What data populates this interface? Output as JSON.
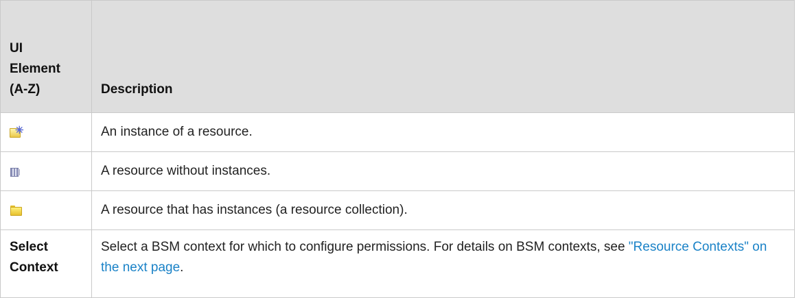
{
  "table": {
    "header": {
      "col1_lines": [
        "UI",
        "Element",
        "(A-Z)"
      ],
      "col2": "Description"
    },
    "rows": [
      {
        "icon": "resource-instance-icon",
        "description": "An instance of a resource."
      },
      {
        "icon": "resource-no-instances-icon",
        "description": "A resource without instances."
      },
      {
        "icon": "resource-collection-folder-icon",
        "description": "A resource that has instances (a resource collection)."
      }
    ],
    "select_context": {
      "label_lines": [
        "Select",
        "Context"
      ],
      "text_before": "Select a BSM context for which to configure permissions. For details on BSM contexts, see ",
      "link": "\"Resource Contexts\" on the next page",
      "text_after": "."
    }
  },
  "colors": {
    "header_bg": "#dedede",
    "border": "#c9c9c9",
    "link": "#1a82c7"
  }
}
